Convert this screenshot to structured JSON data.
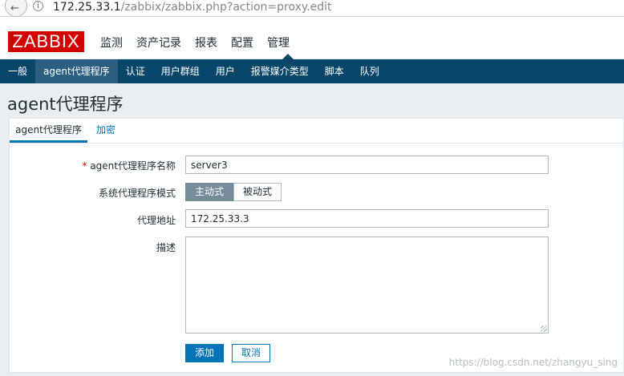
{
  "browser": {
    "url_host": "172.25.33.1",
    "url_path": "/zabbix/zabbix.php?action=proxy.edit"
  },
  "header": {
    "logo": "ZABBIX",
    "menu": [
      "监测",
      "资产记录",
      "报表",
      "配置",
      "管理"
    ]
  },
  "subnav": {
    "items": [
      "一般",
      "agent代理程序",
      "认证",
      "用户群组",
      "用户",
      "报警媒介类型",
      "脚本",
      "队列"
    ],
    "active_index": 1
  },
  "page": {
    "title": "agent代理程序"
  },
  "tabs": [
    "agent代理程序",
    "加密"
  ],
  "form": {
    "name_label": "agent代理程序名称",
    "name_value": "server3",
    "mode_label": "系统代理程序模式",
    "mode_active": "主动式",
    "mode_passive": "被动式",
    "address_label": "代理地址",
    "address_value": "172.25.33.3",
    "description_label": "描述",
    "description_value": "",
    "add_button": "添加",
    "cancel_button": "取消"
  },
  "watermark": "https://blog.csdn.net/zhangyu_sing"
}
